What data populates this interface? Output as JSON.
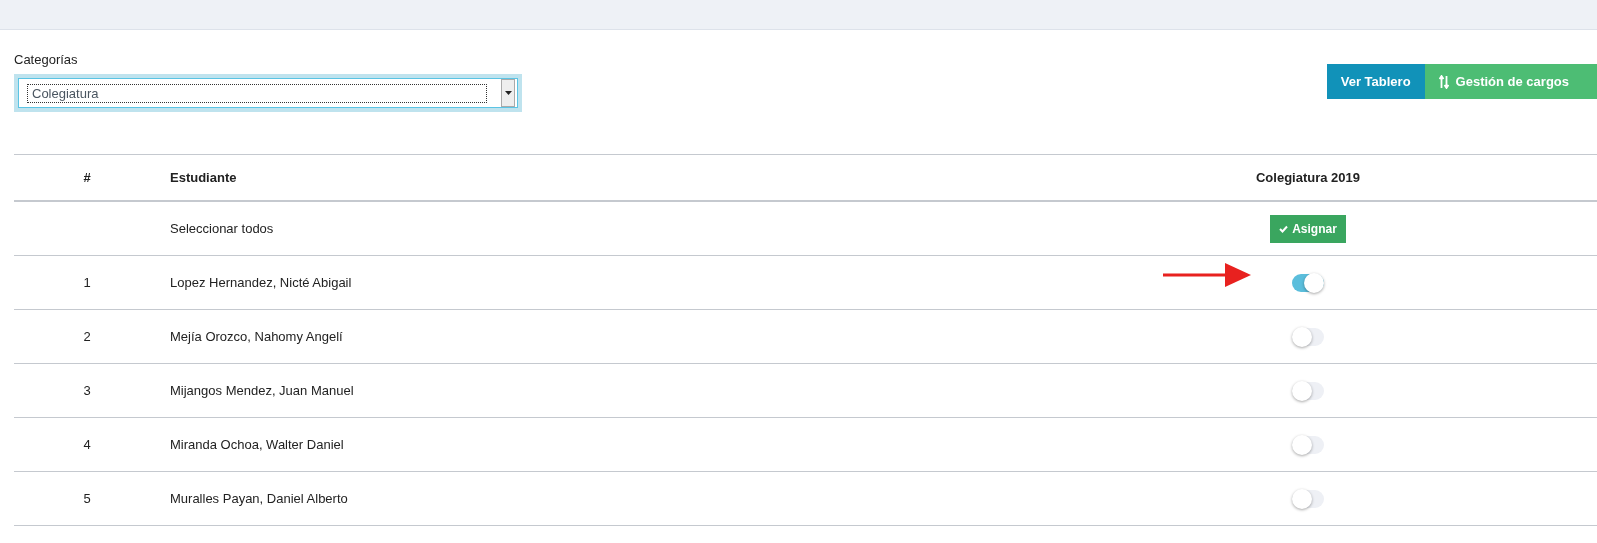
{
  "filter": {
    "label": "Categorías",
    "value": "Colegiatura"
  },
  "buttons": [
    {
      "label": "Ver Tablero",
      "kind": "primary"
    },
    {
      "label": "Gestión de cargos",
      "kind": "success"
    }
  ],
  "table": {
    "columns": [
      "#",
      "Estudiante",
      "Colegiatura 2019"
    ],
    "select_all": {
      "label": "Seleccionar todos",
      "button": "Asignar"
    },
    "rows": [
      {
        "number": "1",
        "name": "Lopez Hernandez, Nicté Abigail",
        "on": true,
        "marked": true
      },
      {
        "number": "2",
        "name": "Mejía Orozco, Nahomy Angelí",
        "on": false,
        "marked": false
      },
      {
        "number": "3",
        "name": "Mijangos Mendez, Juan Manuel",
        "on": false,
        "marked": false
      },
      {
        "number": "4",
        "name": "Miranda Ochoa, Walter Daniel",
        "on": false,
        "marked": false
      },
      {
        "number": "5",
        "name": "Muralles Payan, Daniel Alberto",
        "on": false,
        "marked": false
      }
    ]
  }
}
